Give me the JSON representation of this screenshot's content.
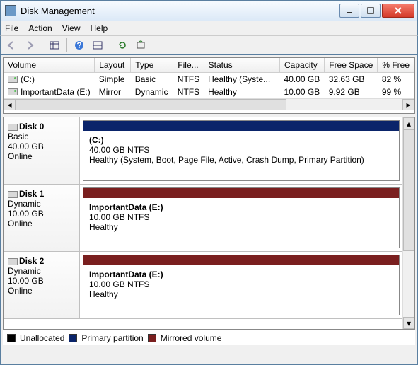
{
  "window": {
    "title": "Disk Management"
  },
  "menu": {
    "file": "File",
    "action": "Action",
    "view": "View",
    "help": "Help"
  },
  "columns": {
    "volume": "Volume",
    "layout": "Layout",
    "type": "Type",
    "file": "File...",
    "status": "Status",
    "capacity": "Capacity",
    "free": "Free Space",
    "pct": "% Free"
  },
  "volumes": [
    {
      "name": "(C:)",
      "layout": "Simple",
      "type": "Basic",
      "fs": "NTFS",
      "status": "Healthy (Syste...",
      "capacity": "40.00 GB",
      "free": "32.63 GB",
      "pct": "82 %"
    },
    {
      "name": "ImportantData (E:)",
      "layout": "Mirror",
      "type": "Dynamic",
      "fs": "NTFS",
      "status": "Healthy",
      "capacity": "10.00 GB",
      "free": "9.92 GB",
      "pct": "99 %"
    }
  ],
  "disks": [
    {
      "name": "Disk 0",
      "dtype": "Basic",
      "size": "40.00 GB",
      "state": "Online",
      "vol": {
        "color": "blue",
        "title": "(C:)",
        "line2": "40.00 GB NTFS",
        "line3": "Healthy (System, Boot, Page File, Active, Crash Dump, Primary Partition)"
      }
    },
    {
      "name": "Disk 1",
      "dtype": "Dynamic",
      "size": "10.00 GB",
      "state": "Online",
      "vol": {
        "color": "maroon",
        "title": "ImportantData  (E:)",
        "line2": "10.00 GB NTFS",
        "line3": "Healthy"
      }
    },
    {
      "name": "Disk 2",
      "dtype": "Dynamic",
      "size": "10.00 GB",
      "state": "Online",
      "vol": {
        "color": "maroon",
        "title": "ImportantData  (E:)",
        "line2": "10.00 GB NTFS",
        "line3": "Healthy"
      }
    }
  ],
  "legend": {
    "unallocated": "Unallocated",
    "primary": "Primary partition",
    "mirrored": "Mirrored volume"
  }
}
